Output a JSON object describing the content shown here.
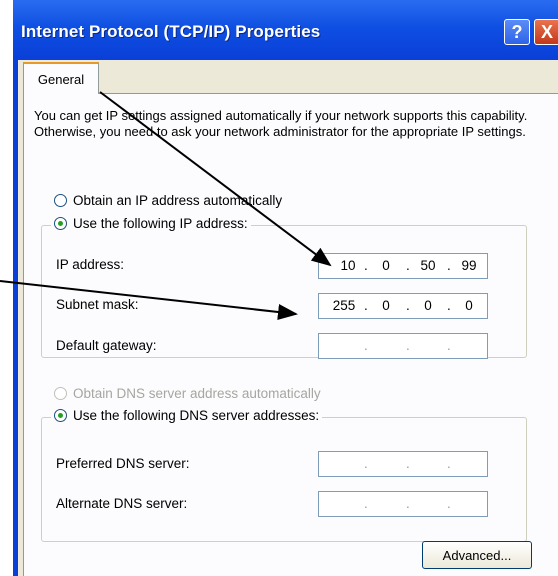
{
  "window": {
    "title": "Internet Protocol (TCP/IP) Properties",
    "help_label": "?",
    "close_label": "X"
  },
  "tab": {
    "label": "General"
  },
  "description": "You can get IP settings assigned automatically if your network supports this capability. Otherwise, you need to ask your network administrator for the appropriate IP settings.",
  "ip_section": {
    "auto_label": "Obtain an IP address automatically",
    "manual_label": "Use the following IP address:",
    "ip_label": "IP address:",
    "ip_value": [
      "10",
      "0",
      "50",
      "99"
    ],
    "subnet_label": "Subnet mask:",
    "subnet_value": [
      "255",
      "0",
      "0",
      "0"
    ],
    "gateway_label": "Default gateway:"
  },
  "dns_section": {
    "auto_label": "Obtain DNS server address automatically",
    "manual_label": "Use the following DNS server addresses:",
    "preferred_label": "Preferred DNS server:",
    "alternate_label": "Alternate DNS server:"
  },
  "buttons": {
    "advanced_label": "Advanced..."
  },
  "colors": {
    "titlebar": "#0a3fd8",
    "dialog": "#ece9d8",
    "tab_accent": "#e69a2c",
    "arrow": "#000000"
  }
}
